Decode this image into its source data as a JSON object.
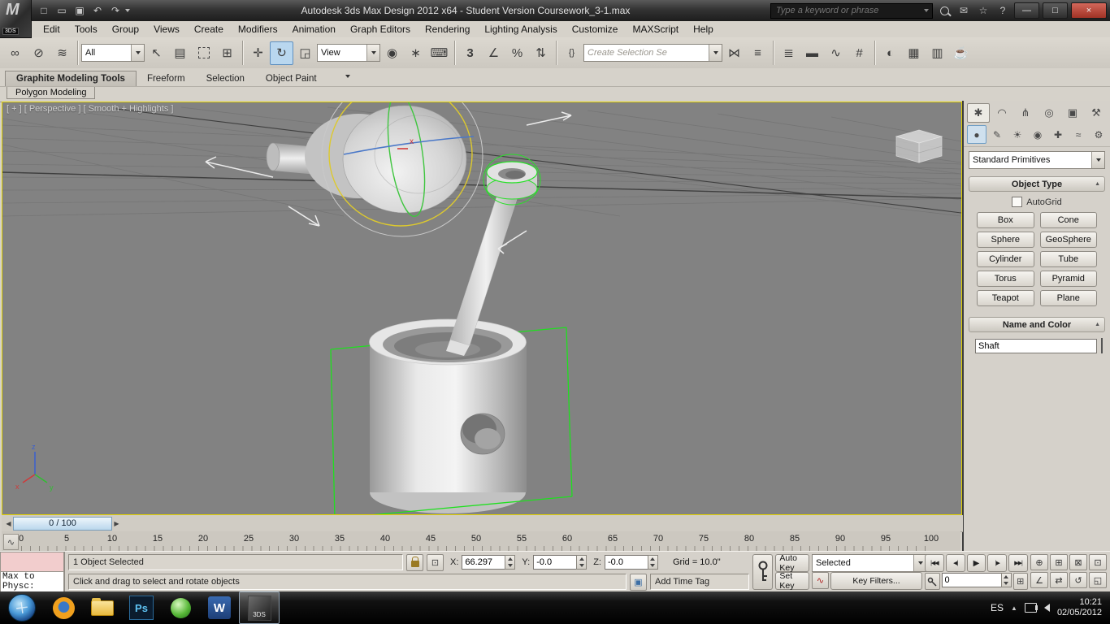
{
  "title_bar": {
    "logo_text": "3DS",
    "title": "Autodesk 3ds Max Design 2012 x64  - Student Version   Coursework_3-1.max",
    "search_placeholder": "Type a keyword or phrase",
    "window": {
      "minimize": "—",
      "maximize": "□",
      "close": "×"
    }
  },
  "menu_bar": {
    "items": [
      "Edit",
      "Tools",
      "Group",
      "Views",
      "Create",
      "Modifiers",
      "Animation",
      "Graph Editors",
      "Rendering",
      "Lighting Analysis",
      "Customize",
      "MAXScript",
      "Help"
    ]
  },
  "toolbar": {
    "filter_value": "All",
    "coord_value": "View",
    "selection_set_placeholder": "Create Selection Se",
    "snap_mode": "3"
  },
  "ribbon": {
    "tabs": [
      "Graphite Modeling Tools",
      "Freeform",
      "Selection",
      "Object Paint"
    ],
    "panel_tab": "Polygon Modeling"
  },
  "viewport": {
    "label": "[ + ] [ Perspective ] [ Smooth + Highlights ]",
    "axis": {
      "x": "x",
      "y": "y",
      "z": "z"
    },
    "gizmo_hint": "x"
  },
  "command_panel": {
    "category_value": "Standard Primitives",
    "object_type": {
      "title": "Object Type",
      "autogrid_label": "AutoGrid",
      "buttons": [
        "Box",
        "Cone",
        "Sphere",
        "GeoSphere",
        "Cylinder",
        "Tube",
        "Torus",
        "Pyramid",
        "Teapot",
        "Plane"
      ]
    },
    "name_and_color": {
      "title": "Name and Color",
      "name_value": "Shaft"
    }
  },
  "time_slider": {
    "value": "0 / 100"
  },
  "timeline": {
    "ticks": [
      "0",
      "5",
      "10",
      "15",
      "20",
      "25",
      "30",
      "35",
      "40",
      "45",
      "50",
      "55",
      "60",
      "65",
      "70",
      "75",
      "80",
      "85",
      "90",
      "95",
      "100"
    ]
  },
  "status_bar": {
    "listener_text": "Max to Physc:",
    "selection_status": "1 Object Selected",
    "coords": {
      "x_label": "X:",
      "y_label": "Y:",
      "z_label": "Z:",
      "x": "66.297",
      "y": "-0.0",
      "z": "-0.0"
    },
    "grid_label": "Grid = 10.0\"",
    "prompt": "Click and drag to select and rotate objects",
    "add_time_tag": "Add Time Tag"
  },
  "animation": {
    "auto_key": "Auto Key",
    "set_key": "Set Key",
    "selected_value": "Selected",
    "key_filters": "Key Filters...",
    "frame_value": "0",
    "playback": [
      "|◀◀",
      "◀|",
      "▶",
      "|▶",
      "▶▶|"
    ]
  },
  "taskbar": {
    "language": "ES",
    "time": "10:21",
    "date": "02/05/2012",
    "ps": "Ps",
    "word": "W",
    "max": "3DS"
  },
  "icons": {
    "qat_new": "□",
    "qat_open": "▭",
    "qat_save": "▣",
    "qat_undo": "↶",
    "qat_redo": "↷",
    "ic_comm": "✉",
    "ic_favorites": "☆",
    "ic_help": "?",
    "link": "∞",
    "unlink": "⊘",
    "bind": "≋",
    "select": "↖",
    "select_by_name": "▤",
    "window_crossing": "⊞",
    "move": "✛",
    "rotate": "↻",
    "scale": "◲",
    "pivot": "◉",
    "manipulate": "∗",
    "keyboard": "⌨",
    "angle_snap": "∠",
    "percent_snap": "%",
    "spinner_snap": "⇅",
    "named_sets": "{}",
    "mirror": "⋈",
    "align": "≡",
    "layers": "≣",
    "ribbon_toggle": "▬",
    "curve_editor": "∿",
    "schematic": "#",
    "material": "◐",
    "render_setup": "▦",
    "rendered_frame": "▥",
    "render": "☕",
    "cp_create": "✱",
    "cp_modify": "◠",
    "cp_hierarchy": "⋔",
    "cp_motion": "◎",
    "cp_display": "▣",
    "cp_utilities": "⚒",
    "cat_geometry": "●",
    "cat_shapes": "✎",
    "cat_lights": "☀",
    "cat_cameras": "◉",
    "cat_helpers": "✚",
    "cat_spacewarps": "≈",
    "cat_systems": "⚙",
    "collapse": "▲",
    "time_tag": "▣",
    "mini_curve": "∿",
    "key_filter_curve": "∿",
    "nav_zoom": "⊕",
    "nav_zoom_all": "⊞",
    "nav_zoom_ext": "⊠",
    "nav_zoom_region": "⊡",
    "nav_fov": "∠",
    "nav_pan": "⇄",
    "nav_orbit": "↺",
    "nav_maximize": "◱",
    "ts_left": "◀",
    "ts_right": "▶",
    "tray_arrow": "▲"
  }
}
